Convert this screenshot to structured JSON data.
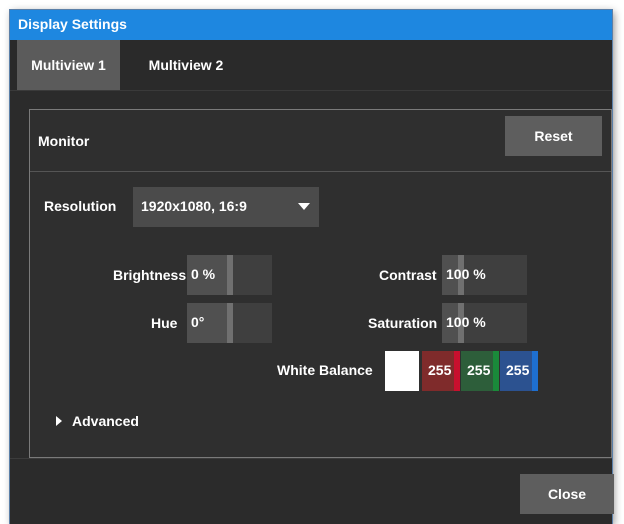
{
  "window": {
    "title": "Display Settings"
  },
  "tabs": [
    {
      "label": "Multiview 1",
      "active": true
    },
    {
      "label": "Multiview 2",
      "active": false
    }
  ],
  "panel": {
    "title": "Monitor",
    "reset_label": "Reset",
    "resolution": {
      "label": "Resolution",
      "value": "1920x1080, 16:9"
    },
    "brightness": {
      "label": "Brightness",
      "value": "0 %",
      "level": 0.0
    },
    "contrast": {
      "label": "Contrast",
      "value": "100 %",
      "level": 0.0
    },
    "hue": {
      "label": "Hue",
      "value": "0°",
      "level": 0.0
    },
    "saturation": {
      "label": "Saturation",
      "value": "100 %",
      "level": 0.0
    },
    "white_balance": {
      "label": "White Balance",
      "swatch_color": "#ffffff",
      "red": "255",
      "green": "255",
      "blue": "255",
      "red_color": "#c8102e",
      "green_color": "#1a8a3a",
      "blue_color": "#1e6fd0"
    },
    "advanced_label": "Advanced"
  },
  "footer": {
    "close_label": "Close"
  },
  "colors": {
    "titlebar": "#1e87e0",
    "background": "#2b2b2b",
    "button": "#5e5e5e"
  },
  "icons": [
    "dropdown-caret-icon",
    "expand-caret-icon"
  ]
}
